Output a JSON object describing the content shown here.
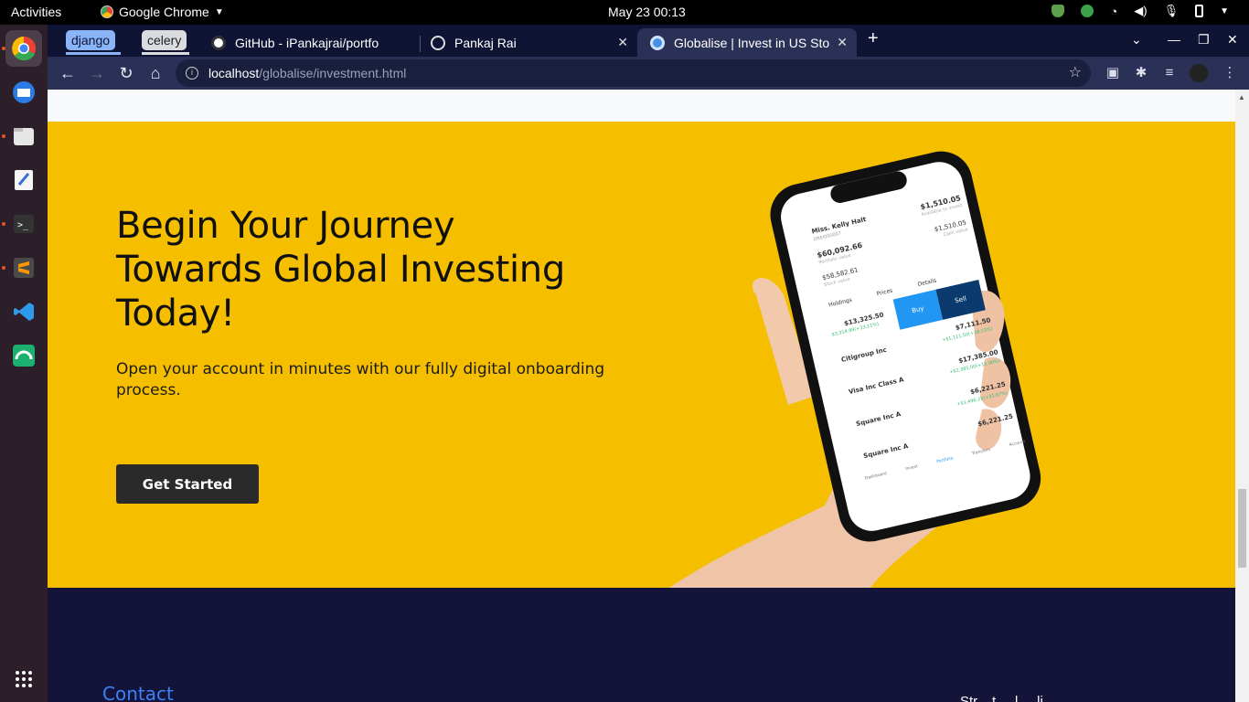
{
  "system": {
    "activities": "Activities",
    "app_name": "Google Chrome",
    "clock": "May 23  00:13"
  },
  "dock": {
    "items": [
      "chrome-icon",
      "thunderbird-icon",
      "files-icon",
      "text-editor-icon",
      "terminal-icon",
      "sublime-icon",
      "vscode-icon",
      "app-icon",
      "app-grid-icon"
    ]
  },
  "browser": {
    "tab_groups": [
      {
        "label": "django",
        "color": "#8ab4f8"
      },
      {
        "label": "celery",
        "color": "#dadce0"
      }
    ],
    "tabs": [
      {
        "title": "GitHub - iPankajrai/portfo"
      },
      {
        "title": "Pankaj Rai"
      },
      {
        "title": "Globalise | Invest in US Sto"
      }
    ],
    "url_host": "localhost",
    "url_path": "/globalise/investment.html"
  },
  "hero": {
    "heading_line1": "Begin Your Journey",
    "heading_line2": "Towards Global Investing",
    "heading_line3": "Today!",
    "subtext": "Open your account in minutes with our fully digital onboarding process.",
    "cta": "Get Started",
    "bg_color": "#f5bf00"
  },
  "phone": {
    "name": "Miss. Kelly Halt",
    "id": "DREI000007",
    "portfolio_value": "$60,092.66",
    "portfolio_label": "Portfolio value",
    "available": "$1,510.05",
    "available_label": "Available to invest",
    "stock_value": "$58,582.61",
    "stock_label": "Stock value",
    "cash": "$1,510.05",
    "cash_label": "Cash value",
    "tabs": [
      "Holdings",
      "Prices",
      "Details"
    ],
    "holding_top_value": "$13,325.50",
    "holding_top_change": "$3,314.99(+33.11%)",
    "buy": "Buy",
    "sell": "Sell",
    "rows": [
      {
        "name": "Citigroup Inc",
        "ticker": "C",
        "value": "$7,111.50",
        "change": "+$1,111.50(+18.53%)"
      },
      {
        "name": "Visa Inc Class A",
        "ticker": "V",
        "value": "$17,385.00",
        "change": "+$2,385.00(+15.90%)"
      },
      {
        "name": "Square Inc A",
        "ticker": "SQ",
        "value": "$6,221.25",
        "change": "+$1,496.25(+31.67%)"
      },
      {
        "name": "Square Inc A",
        "ticker": "",
        "value": "$6,221.25",
        "change": ""
      }
    ],
    "nav": [
      "Dashboard",
      "Invest",
      "Portfolio",
      "Transfers",
      "Account"
    ]
  },
  "footer": {
    "contact": "Contact",
    "trailing_text": "Str... t ... l ... li ... ... ... ... ... ... ... ... ..."
  }
}
